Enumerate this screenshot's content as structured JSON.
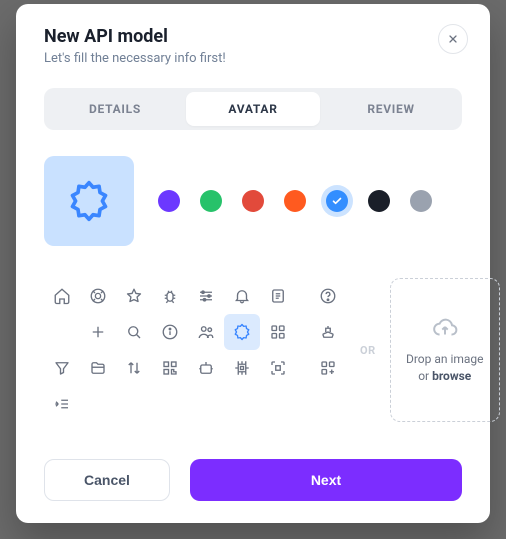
{
  "header": {
    "title": "New API model",
    "subtitle": "Let's fill the necessary info first!"
  },
  "tabs": {
    "details": "DETAILS",
    "avatar": "AVATAR",
    "review": "REVIEW",
    "active": "avatar"
  },
  "colors": {
    "options": [
      "#6c38ff",
      "#27c26a",
      "#e24a3b",
      "#ff5a1f",
      "#338eff",
      "#1a1f29",
      "#9aa2af"
    ],
    "selected_index": 4
  },
  "icons": {
    "selected": "gear-icon"
  },
  "divider": {
    "or_label": "OR"
  },
  "dropzone": {
    "line1": "Drop an image",
    "line2_prefix": "or ",
    "line2_action": "browse"
  },
  "footer": {
    "cancel": "Cancel",
    "next": "Next"
  }
}
